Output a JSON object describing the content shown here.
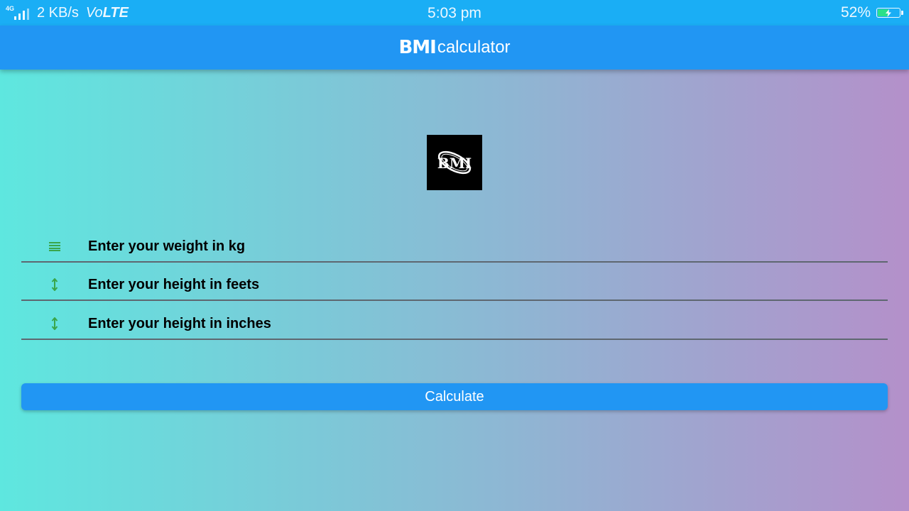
{
  "status_bar": {
    "network_type": "4G",
    "data_speed": "2 KB/s",
    "volte_prefix": "Vo",
    "volte_suffix": "LTE",
    "time": "5:03 pm",
    "battery_percent": "52%",
    "battery_level": 0.52,
    "icons": [
      "signal-icon",
      "battery-charging-icon"
    ]
  },
  "app_bar": {
    "brand_bold": "BMI",
    "brand_rest": "calculator"
  },
  "logo": {
    "text": "BMI"
  },
  "form": {
    "weight": {
      "placeholder": "Enter your weight in kg",
      "value": "",
      "icon": "scale-lines-icon"
    },
    "height_feet": {
      "placeholder": "Enter your height in feets",
      "value": "",
      "icon": "height-arrows-icon"
    },
    "height_inches": {
      "placeholder": "Enter your height in inches",
      "value": "",
      "icon": "height-arrows-icon"
    }
  },
  "actions": {
    "calculate_label": "Calculate"
  },
  "colors": {
    "status_bar": "#1aaef5",
    "app_bar": "#2196f3",
    "gradient_start": "#5ee7df",
    "gradient_end": "#b490ca",
    "icon_green": "#3aa54a",
    "button": "#2196f3"
  }
}
